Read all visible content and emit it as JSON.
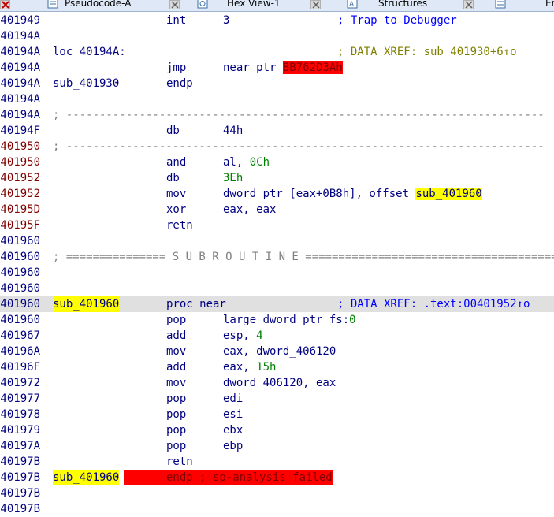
{
  "tabs": [
    {
      "label": "Pseudocode-A",
      "icon": "pseudocode-icon"
    },
    {
      "label": "Hex View-1",
      "icon": "hex-view-icon"
    },
    {
      "label": "Structures",
      "icon": "structures-icon"
    },
    {
      "label": "Er",
      "icon": "enums-icon"
    }
  ],
  "lines": [
    {
      "addr": "0401949",
      "mn": "int",
      "op": "3",
      "comment": "; Trap to Debugger"
    },
    {
      "addr": "040194A"
    },
    {
      "addr": "040194A",
      "label": "loc_40194A:",
      "comment": "; DATA XREF: sub_401930+6↑o"
    },
    {
      "addr": "040194A",
      "mn": "jmp",
      "op_pre": "near ptr ",
      "op_hl": "8B762D3Ah"
    },
    {
      "addr": "040194A",
      "label": "sub_401930",
      "mn": "endp"
    },
    {
      "addr": "040194A"
    },
    {
      "addr": "040194A",
      "sep": "; ------------------------------------------------------------------------"
    },
    {
      "addr": "040194F",
      "mn": "db",
      "op": "44h"
    },
    {
      "addr": "0401950",
      "sep": "; ------------------------------------------------------------------------"
    },
    {
      "addr": "0401950",
      "mn": "and",
      "op_pre": "al, ",
      "op_num": "0Ch"
    },
    {
      "addr": "0401952",
      "mn": "db",
      "op_num_only": "3Eh"
    },
    {
      "addr": "0401952",
      "mn": "mov",
      "op_pre": "dword ptr [eax+0B8h], offset ",
      "op_hl_y": "sub_401960"
    },
    {
      "addr": "040195D",
      "mn": "xor",
      "op": "eax, eax"
    },
    {
      "addr": "040195F",
      "mn": "retn"
    },
    {
      "addr": "0401960"
    },
    {
      "addr": "0401960",
      "sep": "; =============== S U B R O U T I N E ======================================="
    },
    {
      "addr": "0401960"
    },
    {
      "addr": "0401960"
    },
    {
      "addr": "0401960",
      "label_hl": "sub_401960",
      "mn": "proc near",
      "comment": "; DATA XREF: .text:00401952↑o",
      "selected": true
    },
    {
      "addr": "0401960",
      "mn": "pop",
      "op_pre": "large dword ptr fs:",
      "op_num": "0"
    },
    {
      "addr": "0401967",
      "mn": "add",
      "op_pre": "esp, ",
      "op_num": "4"
    },
    {
      "addr": "040196A",
      "mn": "mov",
      "op": "eax, dword_406120"
    },
    {
      "addr": "040196F",
      "mn": "add",
      "op_pre": "eax, ",
      "op_num": "15h"
    },
    {
      "addr": "0401972",
      "mn": "mov",
      "op": "dword_406120, eax"
    },
    {
      "addr": "0401977",
      "mn": "pop",
      "op": "edi"
    },
    {
      "addr": "0401978",
      "mn": "pop",
      "op": "esi"
    },
    {
      "addr": "0401979",
      "mn": "pop",
      "op": "ebx"
    },
    {
      "addr": "040197A",
      "mn": "pop",
      "op": "ebp"
    },
    {
      "addr": "040197B",
      "mn": "retn"
    },
    {
      "addr": "040197B",
      "label_hl": "sub_401960",
      "mn_red": "endp ; sp-analysis failed"
    },
    {
      "addr": "040197B"
    },
    {
      "addr": "040197B"
    }
  ]
}
